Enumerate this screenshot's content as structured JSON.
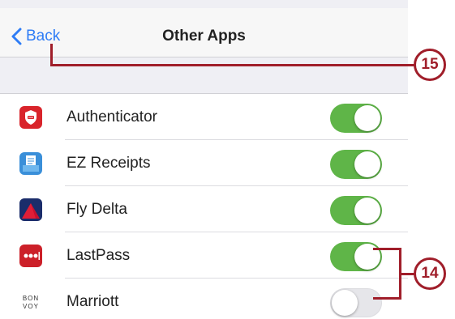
{
  "navbar": {
    "back_label": "Back",
    "title": "Other Apps"
  },
  "apps": [
    {
      "name": "Authenticator",
      "enabled": true,
      "icon": "authenticator-icon"
    },
    {
      "name": "EZ Receipts",
      "enabled": true,
      "icon": "ez-receipts-icon"
    },
    {
      "name": "Fly Delta",
      "enabled": true,
      "icon": "fly-delta-icon"
    },
    {
      "name": "LastPass",
      "enabled": true,
      "icon": "lastpass-icon"
    },
    {
      "name": "Marriott",
      "enabled": false,
      "icon": "marriott-bonvoy-icon"
    }
  ],
  "marriott_icon_text": "BON VOY",
  "callouts": {
    "back": "15",
    "toggles": "14"
  },
  "colors": {
    "accent": "#2f7df6",
    "toggle_on": "#5fb548",
    "callout": "#a01e2a"
  }
}
